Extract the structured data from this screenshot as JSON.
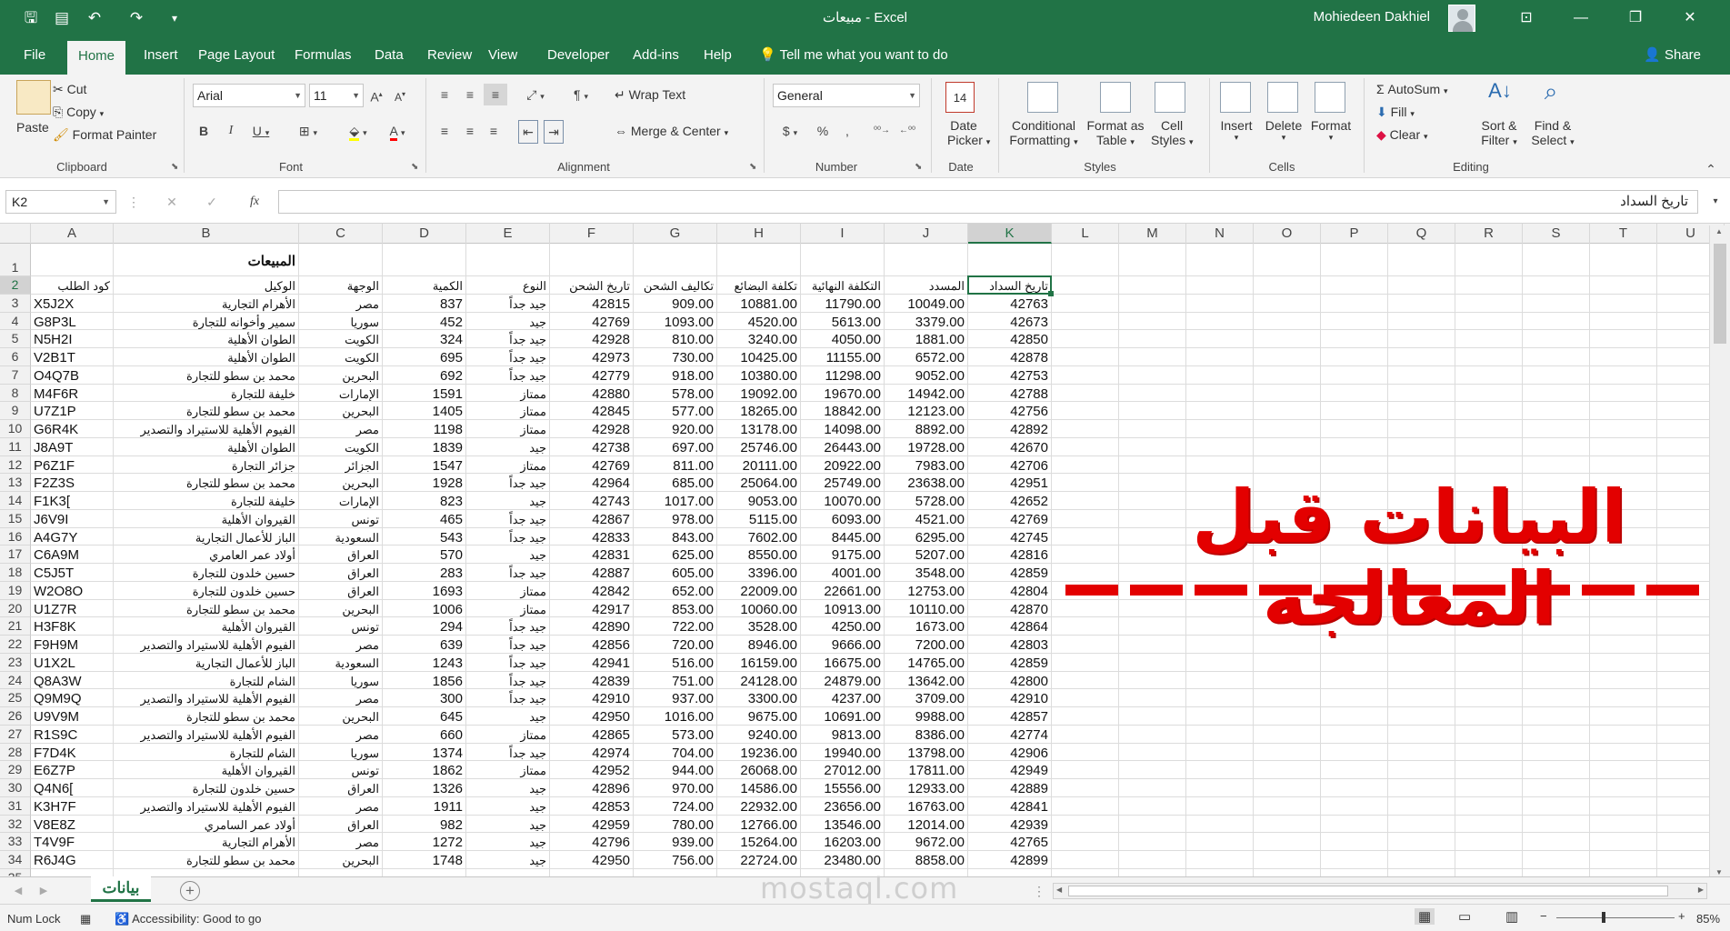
{
  "window": {
    "title": "مبيعات  -  Excel",
    "user": "Mohiedeen Dakhiel"
  },
  "tabs": [
    "File",
    "Home",
    "Insert",
    "Page Layout",
    "Formulas",
    "Data",
    "Review",
    "View",
    "Developer",
    "Add-ins",
    "Help"
  ],
  "active_tab": "Home",
  "tell_me": "Tell me what you want to do",
  "share": "Share",
  "ribbon": {
    "clipboard": {
      "paste": "Paste",
      "cut": "Cut",
      "copy": "Copy",
      "format_painter": "Format Painter",
      "label": "Clipboard"
    },
    "font": {
      "name": "Arial",
      "size": "11",
      "label": "Font"
    },
    "alignment": {
      "wrap": "Wrap Text",
      "merge": "Merge & Center",
      "label": "Alignment"
    },
    "number": {
      "format": "General",
      "label": "Number"
    },
    "date": {
      "picker_line1": "Date",
      "picker_line2": "Picker",
      "label": "Date"
    },
    "styles": {
      "cond_line1": "Conditional",
      "cond_line2": "Formatting",
      "fmt_line1": "Format as",
      "fmt_line2": "Table",
      "cell_line1": "Cell",
      "cell_line2": "Styles",
      "label": "Styles"
    },
    "cells": {
      "insert": "Insert",
      "delete": "Delete",
      "format": "Format",
      "label": "Cells"
    },
    "editing": {
      "autosum": "AutoSum",
      "fill": "Fill",
      "clear": "Clear",
      "sort_line1": "Sort &",
      "sort_line2": "Filter",
      "find_line1": "Find &",
      "find_line2": "Select",
      "label": "Editing"
    }
  },
  "formula_bar": {
    "name_box": "K2",
    "content": "تاريخ السداد"
  },
  "columns": [
    "A",
    "B",
    "C",
    "D",
    "E",
    "F",
    "G",
    "H",
    "I",
    "J",
    "K",
    "L",
    "M",
    "N",
    "O",
    "P",
    "Q",
    "R",
    "S",
    "T",
    "U"
  ],
  "selected_column": "K",
  "selected_row": 2,
  "title_cell": "المبيعات",
  "headers": [
    "كود الطلب",
    "الوكيل",
    "الوجهة",
    "الكمية",
    "النوع",
    "تاريخ الشحن",
    "تكاليف الشحن",
    "تكلفة البضائع",
    "التكلفة النهائية",
    "المسدد",
    "تاريخ السداد"
  ],
  "rows": [
    [
      "X5J2X",
      "الأهرام التجارية",
      "مصر",
      "837",
      "جيد جداً",
      "42815",
      "909.00",
      "10881.00",
      "11790.00",
      "10049.00",
      "42763"
    ],
    [
      "G8P3L",
      "سمير وأخوانه للتجارة",
      "سوريا",
      "452",
      "جيد",
      "42769",
      "1093.00",
      "4520.00",
      "5613.00",
      "3379.00",
      "42673"
    ],
    [
      "N5H2I",
      "الطوان الأهلية",
      "الكويت",
      "324",
      "جيد جداً",
      "42928",
      "810.00",
      "3240.00",
      "4050.00",
      "1881.00",
      "42850"
    ],
    [
      "V2B1T",
      "الطوان الأهلية",
      "الكويت",
      "695",
      "جيد جداً",
      "42973",
      "730.00",
      "10425.00",
      "11155.00",
      "6572.00",
      "42878"
    ],
    [
      "O4Q7B",
      "محمد بن سطو للتجارة",
      "البحرين",
      "692",
      "جيد جداً",
      "42779",
      "918.00",
      "10380.00",
      "11298.00",
      "9052.00",
      "42753"
    ],
    [
      "M4F6R",
      "خليفة للتجارة",
      "الإمارات",
      "1591",
      "ممتاز",
      "42880",
      "578.00",
      "19092.00",
      "19670.00",
      "14942.00",
      "42788"
    ],
    [
      "U7Z1P",
      "محمد بن سطو للتجارة",
      "البحرين",
      "1405",
      "ممتاز",
      "42845",
      "577.00",
      "18265.00",
      "18842.00",
      "12123.00",
      "42756"
    ],
    [
      "G6R4K",
      "الفيوم الأهلية للاستيراد والتصدير",
      "مصر",
      "1198",
      "ممتاز",
      "42928",
      "920.00",
      "13178.00",
      "14098.00",
      "8892.00",
      "42892"
    ],
    [
      "J8A9T",
      "الطوان الأهلية",
      "الكويت",
      "1839",
      "جيد",
      "42738",
      "697.00",
      "25746.00",
      "26443.00",
      "19728.00",
      "42670"
    ],
    [
      "P6Z1F",
      "جزائر التجارة",
      "الجزائر",
      "1547",
      "ممتاز",
      "42769",
      "811.00",
      "20111.00",
      "20922.00",
      "7983.00",
      "42706"
    ],
    [
      "F2Z3S",
      "محمد بن سطو للتجارة",
      "البحرين",
      "1928",
      "جيد جداً",
      "42964",
      "685.00",
      "25064.00",
      "25749.00",
      "23638.00",
      "42951"
    ],
    [
      "F1K3[",
      "خليفة للتجارة",
      "الإمارات",
      "823",
      "جيد",
      "42743",
      "1017.00",
      "9053.00",
      "10070.00",
      "5728.00",
      "42652"
    ],
    [
      "J6V9I",
      "القيروان الأهلية",
      "تونس",
      "465",
      "جيد جداً",
      "42867",
      "978.00",
      "5115.00",
      "6093.00",
      "4521.00",
      "42769"
    ],
    [
      "A4G7Y",
      "الباز للأعمال التجارية",
      "السعودية",
      "543",
      "جيد جداً",
      "42833",
      "843.00",
      "7602.00",
      "8445.00",
      "6295.00",
      "42745"
    ],
    [
      "C6A9M",
      "أولاد عمر العامري",
      "العراق",
      "570",
      "جيد",
      "42831",
      "625.00",
      "8550.00",
      "9175.00",
      "5207.00",
      "42816"
    ],
    [
      "C5J5T",
      "حسين خلدون للتجارة",
      "العراق",
      "283",
      "جيد جداً",
      "42887",
      "605.00",
      "3396.00",
      "4001.00",
      "3548.00",
      "42859"
    ],
    [
      "W2O8O",
      "حسين خلدون للتجارة",
      "العراق",
      "1693",
      "ممتاز",
      "42842",
      "652.00",
      "22009.00",
      "22661.00",
      "12753.00",
      "42804"
    ],
    [
      "U1Z7R",
      "محمد بن سطو للتجارة",
      "البحرين",
      "1006",
      "ممتاز",
      "42917",
      "853.00",
      "10060.00",
      "10913.00",
      "10110.00",
      "42870"
    ],
    [
      "H3F8K",
      "القيروان الأهلية",
      "تونس",
      "294",
      "جيد جداً",
      "42890",
      "722.00",
      "3528.00",
      "4250.00",
      "1673.00",
      "42864"
    ],
    [
      "F9H9M",
      "الفيوم الأهلية للاستيراد والتصدير",
      "مصر",
      "639",
      "جيد جداً",
      "42856",
      "720.00",
      "8946.00",
      "9666.00",
      "7200.00",
      "42803"
    ],
    [
      "U1X2L",
      "الباز للأعمال التجارية",
      "السعودية",
      "1243",
      "جيد جداً",
      "42941",
      "516.00",
      "16159.00",
      "16675.00",
      "14765.00",
      "42859"
    ],
    [
      "Q8A3W",
      "الشام للتجارة",
      "سوريا",
      "1856",
      "جيد جداً",
      "42839",
      "751.00",
      "24128.00",
      "24879.00",
      "13642.00",
      "42800"
    ],
    [
      "Q9M9Q",
      "الفيوم الأهلية للاستيراد والتصدير",
      "مصر",
      "300",
      "جيد جداً",
      "42910",
      "937.00",
      "3300.00",
      "4237.00",
      "3709.00",
      "42910"
    ],
    [
      "U9V9M",
      "محمد بن سطو للتجارة",
      "البحرين",
      "645",
      "جيد",
      "42950",
      "1016.00",
      "9675.00",
      "10691.00",
      "9988.00",
      "42857"
    ],
    [
      "R1S9C",
      "الفيوم الأهلية للاستيراد والتصدير",
      "مصر",
      "660",
      "ممتاز",
      "42865",
      "573.00",
      "9240.00",
      "9813.00",
      "8386.00",
      "42774"
    ],
    [
      "F7D4K",
      "الشام للتجارة",
      "سوريا",
      "1374",
      "جيد جداً",
      "42974",
      "704.00",
      "19236.00",
      "19940.00",
      "13798.00",
      "42906"
    ],
    [
      "E6Z7P",
      "القيروان الأهلية",
      "تونس",
      "1862",
      "ممتاز",
      "42952",
      "944.00",
      "26068.00",
      "27012.00",
      "17811.00",
      "42949"
    ],
    [
      "Q4N6[",
      "حسين خلدون للتجارة",
      "العراق",
      "1326",
      "جيد",
      "42896",
      "970.00",
      "14586.00",
      "15556.00",
      "12933.00",
      "42889"
    ],
    [
      "K3H7F",
      "الفيوم الأهلية للاستيراد والتصدير",
      "مصر",
      "1911",
      "جيد",
      "42853",
      "724.00",
      "22932.00",
      "23656.00",
      "16763.00",
      "42841"
    ],
    [
      "V8E8Z",
      "أولاد عمر السامري",
      "العراق",
      "982",
      "جيد",
      "42959",
      "780.00",
      "12766.00",
      "13546.00",
      "12014.00",
      "42939"
    ],
    [
      "T4V9F",
      "الأهرام التجارية",
      "مصر",
      "1272",
      "جيد",
      "42796",
      "939.00",
      "15264.00",
      "16203.00",
      "9672.00",
      "42765"
    ],
    [
      "R6J4G",
      "محمد بن سطو للتجارة",
      "البحرين",
      "1748",
      "جيد",
      "42950",
      "756.00",
      "22724.00",
      "23480.00",
      "8858.00",
      "42899"
    ]
  ],
  "overlay": {
    "text": "البيانات قبل المعالجة"
  },
  "sheet_tab": "بيانات",
  "status": {
    "num_lock": "Num Lock",
    "accessibility": "Accessibility: Good to go",
    "zoom": "85%"
  },
  "watermark": "mostaql.com"
}
